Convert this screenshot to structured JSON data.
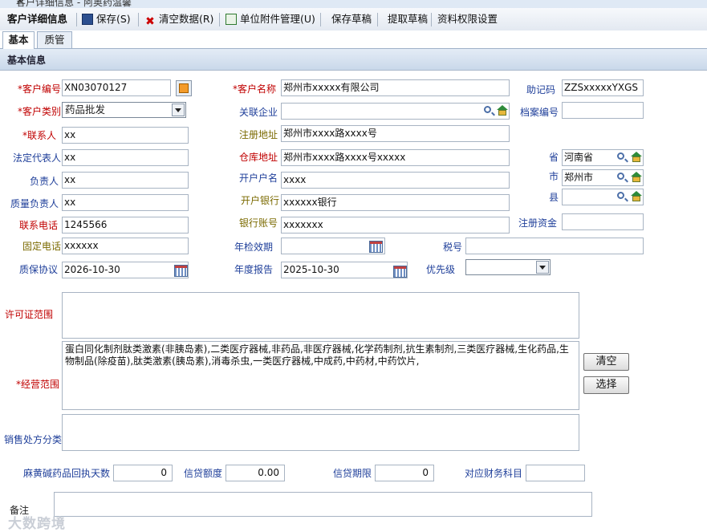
{
  "window": {
    "title": "客户详细信息 - 阿奥药温馨",
    "close": "✕"
  },
  "toolbar": {
    "title": "客户详细信息",
    "save": "保存(S)",
    "clear_data": "清空数据(R)",
    "attachments": "单位附件管理(U)",
    "save_draft": "保存草稿",
    "load_draft": "提取草稿",
    "permissions": "资料权限设置"
  },
  "tabs": [
    "基本",
    "质管"
  ],
  "section": "基本信息",
  "labels": {
    "customer_code": "*客户编号",
    "customer_category": "*客户类别",
    "contact": "*联系人",
    "legal_rep": "法定代表人",
    "manager": "负责人",
    "quality_manager": "质量负责人",
    "contact_phone": "联系电话",
    "fixed_phone": "固定电话",
    "quality_agreement": "质保协议",
    "customer_name": "*客户名称",
    "related_company": "关联企业",
    "reg_address": "注册地址",
    "warehouse_address": "仓库地址",
    "account_name": "开户户名",
    "bank": "开户银行",
    "bank_account": "银行账号",
    "annual_check_date": "年检效期",
    "annual_report": "年度报告",
    "mnemonic": "助记码",
    "archive_no": "档案编号",
    "province": "省",
    "city": "市",
    "county": "县",
    "reg_capital": "注册资金",
    "tax_no": "税号",
    "priority": "优先级",
    "license_scope": "许可证范围",
    "business_scope": "*经营范围",
    "sales_rx_category": "销售处方分类",
    "ephedrine_days": "麻黄碱药品回执天数",
    "credit_limit": "信贷额度",
    "credit_period": "信贷期限",
    "account_subject": "对应财务科目",
    "remark": "备注"
  },
  "values": {
    "customer_code": "XN03070127",
    "customer_category": "药品批发",
    "contact": "xx",
    "legal_rep": "xx",
    "manager": "xx",
    "quality_manager": "xx",
    "contact_phone": "1245566",
    "fixed_phone": "xxxxxx",
    "quality_agreement": "2026-10-30",
    "customer_name": "郑州市xxxxx有限公司",
    "related_company": "",
    "reg_address": "郑州市xxxx路xxxx号",
    "warehouse_address": "郑州市xxxx路xxxx号xxxxx",
    "account_name": "xxxx",
    "bank": "xxxxxx银行",
    "bank_account": "xxxxxxx",
    "annual_check_date": "",
    "annual_report": "2025-10-30",
    "mnemonic": "ZZSxxxxxYXGS",
    "archive_no": "",
    "province": "河南省",
    "city": "郑州市",
    "county": "",
    "reg_capital": "",
    "tax_no": "",
    "priority": "",
    "license_scope": "",
    "business_scope": "蛋白同化制剂肽类激素(非胰岛素),二类医疗器械,非药品,非医疗器械,化学药制剂,抗生素制剂,三类医疗器械,生化药品,生物制品(除疫苗),肽类激素(胰岛素),消毒杀虫,一类医疗器械,中成药,中药材,中药饮片,",
    "sales_rx_category": "",
    "ephedrine_days": "0",
    "credit_limit": "0.00",
    "credit_period": "0",
    "account_subject": "",
    "remark": ""
  },
  "buttons": {
    "clear": "清空",
    "select": "选择"
  },
  "watermark": "大数跨境",
  "colors": {
    "required": "#c00000",
    "label_blue": "#1f3f9a",
    "label_olive": "#7b6a00",
    "toolbar_bg": "#e3e9f1",
    "section_bg": "#c9d8ea"
  }
}
